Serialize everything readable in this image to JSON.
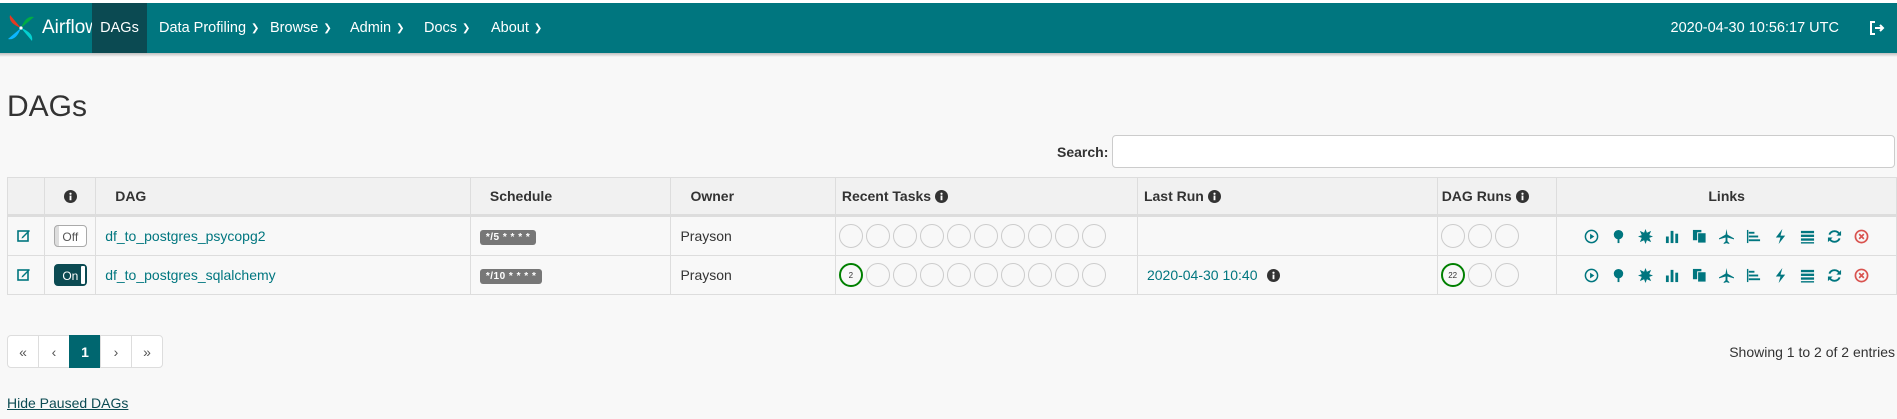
{
  "navbar": {
    "brand": "Airflow",
    "items": [
      {
        "label": "DAGs",
        "active": true,
        "dropdown": false
      },
      {
        "label": "Data Profiling",
        "dropdown": true
      },
      {
        "label": "Browse",
        "dropdown": true
      },
      {
        "label": "Admin",
        "dropdown": true
      },
      {
        "label": "Docs",
        "dropdown": true
      },
      {
        "label": "About",
        "dropdown": true
      }
    ],
    "clock": "2020-04-30 10:56:17 UTC",
    "logout_icon": "sign-out-icon"
  },
  "page": {
    "title": "DAGs",
    "search_label": "Search:",
    "search_value": ""
  },
  "table": {
    "headers": {
      "info": "info-icon",
      "dag": "DAG",
      "schedule": "Schedule",
      "owner": "Owner",
      "recent_tasks": "Recent Tasks",
      "last_run": "Last Run",
      "dag_runs": "DAG Runs",
      "links": "Links"
    },
    "rows": [
      {
        "toggle": "Off",
        "dag": "df_to_postgres_psycopg2",
        "schedule": "*/5 * * * *",
        "owner": "Prayson",
        "recent_tasks_success": "",
        "last_run": "",
        "dag_runs_success": ""
      },
      {
        "toggle": "On",
        "dag": "df_to_postgres_sqlalchemy",
        "schedule": "*/10 * * * *",
        "owner": "Prayson",
        "recent_tasks_success": "2",
        "last_run": "2020-04-30 10:40",
        "dag_runs_success": "22"
      }
    ],
    "link_icons": [
      "trigger-dag-icon",
      "tree-view-icon",
      "graph-view-icon",
      "task-duration-icon",
      "task-tries-icon",
      "landing-times-icon",
      "gantt-icon",
      "code-icon",
      "logs-icon",
      "refresh-icon",
      "delete-icon"
    ]
  },
  "footer": {
    "showing": "Showing 1 to 2 of 2 entries",
    "pagination": [
      "«",
      "‹",
      "1",
      "›",
      "»"
    ],
    "active_page": "1",
    "hide_paused": "Hide Paused DAGs"
  },
  "colors": {
    "navbar": "#00767f",
    "active_nav": "#0b4a52",
    "link": "#00767f",
    "success": "#008000",
    "delete": "#d9534f"
  }
}
